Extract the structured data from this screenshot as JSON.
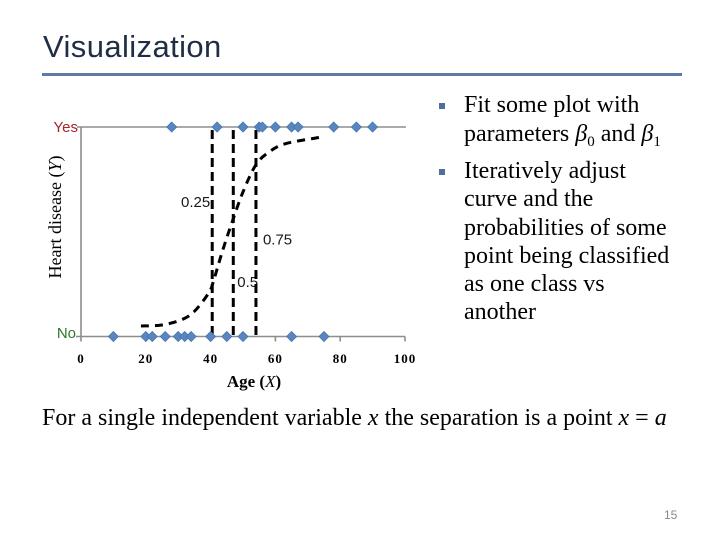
{
  "slide": {
    "title": "Visualization",
    "page_number": "15"
  },
  "bullets": [
    {
      "marker": "square-bullet",
      "line1": "Fit some plot with",
      "line2": {
        "prefix": "parameters ",
        "beta": "β",
        "sub0": "0",
        "mid": " and ",
        "sub1": "1"
      }
    },
    {
      "marker": "square-bullet",
      "lines": [
        "Iteratively adjust",
        "curve and the",
        "probabilities of some",
        "point being classified",
        "as one class vs",
        "another"
      ]
    }
  ],
  "statement": {
    "parts": [
      "For a single independent variable ",
      "x",
      " the separation is a point ",
      "x",
      " = ",
      "a"
    ]
  },
  "chart_data": {
    "type": "scatter",
    "title": "",
    "xlabel": "Age (X)",
    "xlabel_parts": [
      "Age (",
      "X",
      ")"
    ],
    "ylabel": "Heart disease (Y)",
    "ylabel_parts": [
      "Heart disease (",
      "Y",
      ")"
    ],
    "xlim": [
      0,
      100
    ],
    "xticks": [
      0,
      20,
      40,
      60,
      80,
      100
    ],
    "xtick_labels": [
      "0",
      "20",
      "40",
      "60",
      "80",
      "100"
    ],
    "y_categories": [
      "No",
      "Yes"
    ],
    "grid": false,
    "legend": "none",
    "series": [
      {
        "name": "Heart disease = Yes",
        "y": "Yes",
        "x": [
          28,
          42,
          50,
          55,
          56,
          60,
          65,
          67,
          78,
          85,
          90
        ]
      },
      {
        "name": "Heart disease = No",
        "y": "No",
        "x": [
          10,
          20,
          22,
          26,
          30,
          32,
          34,
          40,
          45,
          50,
          65,
          75
        ]
      }
    ],
    "logistic_curve": {
      "type": "line",
      "style": "dashed",
      "points": [
        [
          18.5,
          0.05
        ],
        [
          25,
          0.055
        ],
        [
          31,
          0.08
        ],
        [
          35,
          0.12
        ],
        [
          39.5,
          0.21
        ],
        [
          41,
          0.27
        ],
        [
          43.5,
          0.4
        ],
        [
          46.5,
          0.54
        ],
        [
          50,
          0.69
        ],
        [
          54,
          0.82
        ],
        [
          58,
          0.88
        ],
        [
          63,
          0.92
        ],
        [
          73.5,
          0.95
        ]
      ]
    },
    "thresholds": [
      {
        "x": 40.5,
        "label": "0.25"
      },
      {
        "x": 47,
        "label": "0.5"
      },
      {
        "x": 54,
        "label": "0.75"
      }
    ],
    "colors": {
      "marker_fill": "#5a86c0",
      "marker_stroke": "#4675ae",
      "yes_label": "#a0262a",
      "no_label": "#2b7a2b",
      "axis": "#8e8e8e",
      "curve": "#000000"
    }
  }
}
